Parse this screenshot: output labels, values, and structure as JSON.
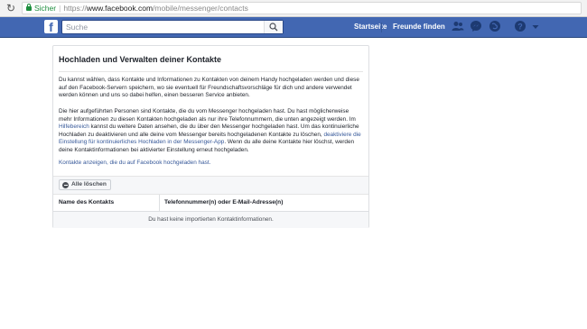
{
  "browser": {
    "secure_label": "Sicher",
    "url_scheme": "https://",
    "url_host": "www.facebook.com",
    "url_path": "/mobile/messenger/contacts"
  },
  "fb": {
    "logo": "f",
    "search_placeholder": "Suche",
    "nav_home": "Startseite",
    "nav_find_friends": "Freunde finden"
  },
  "panel": {
    "title": "Hochladen und Verwalten deiner Kontakte",
    "para1": "Du kannst wählen, dass Kontakte und Informationen zu Kontakten von deinem Handy hochgeladen werden und diese auf den Facebook-Servern speichern, wo sie eventuell für Freundschaftsvorschläge für dich und andere verwendet werden können und uns so dabei helfen, einen besseren Service anbieten.",
    "para2_a": "Die hier aufgeführten Personen sind Kontakte, die du vom Messenger hochgeladen hast. Du hast möglicherweise mehr Informationen zu diesen Kontakten hochgeladen als nur ihre Telefonnummern, die unten angezeigt werden. Im ",
    "para2_link1": "Hilfebereich",
    "para2_b": " kannst du weitere Daten ansehen, die du über den Messenger hochgeladen hast. Um das kontinuierliche Hochladen zu deaktivieren und alle deine vom Messenger bereits hochgeladenen Kontakte zu löschen, ",
    "para2_link2": "deaktiviere die Einstellung für kontinuierliches Hochladen in der Messenger-App",
    "para2_c": ". Wenn du alle deine Kontakte hier löschst, werden deine Kontaktinformationen bei aktivierter Einstellung erneut hochgeladen.",
    "para3_link": "Kontakte anzeigen, die du auf Facebook hochgeladen hast.",
    "delete_all": "Alle löschen",
    "col_name": "Name des Kontakts",
    "col_phone": "Telefonnummer(n) oder E-Mail-Adresse(n)",
    "empty_message": "Du hast keine importierten Kontaktinformationen."
  },
  "icons": [
    "reload-icon",
    "lock-icon",
    "search-icon",
    "friend-requests-icon",
    "messages-icon",
    "notifications-icon",
    "help-icon",
    "dropdown-arrow-icon",
    "delete-icon"
  ],
  "colors": {
    "fb_blue": "#4267b2",
    "link": "#365899",
    "secure_green": "#1e8e3e"
  }
}
